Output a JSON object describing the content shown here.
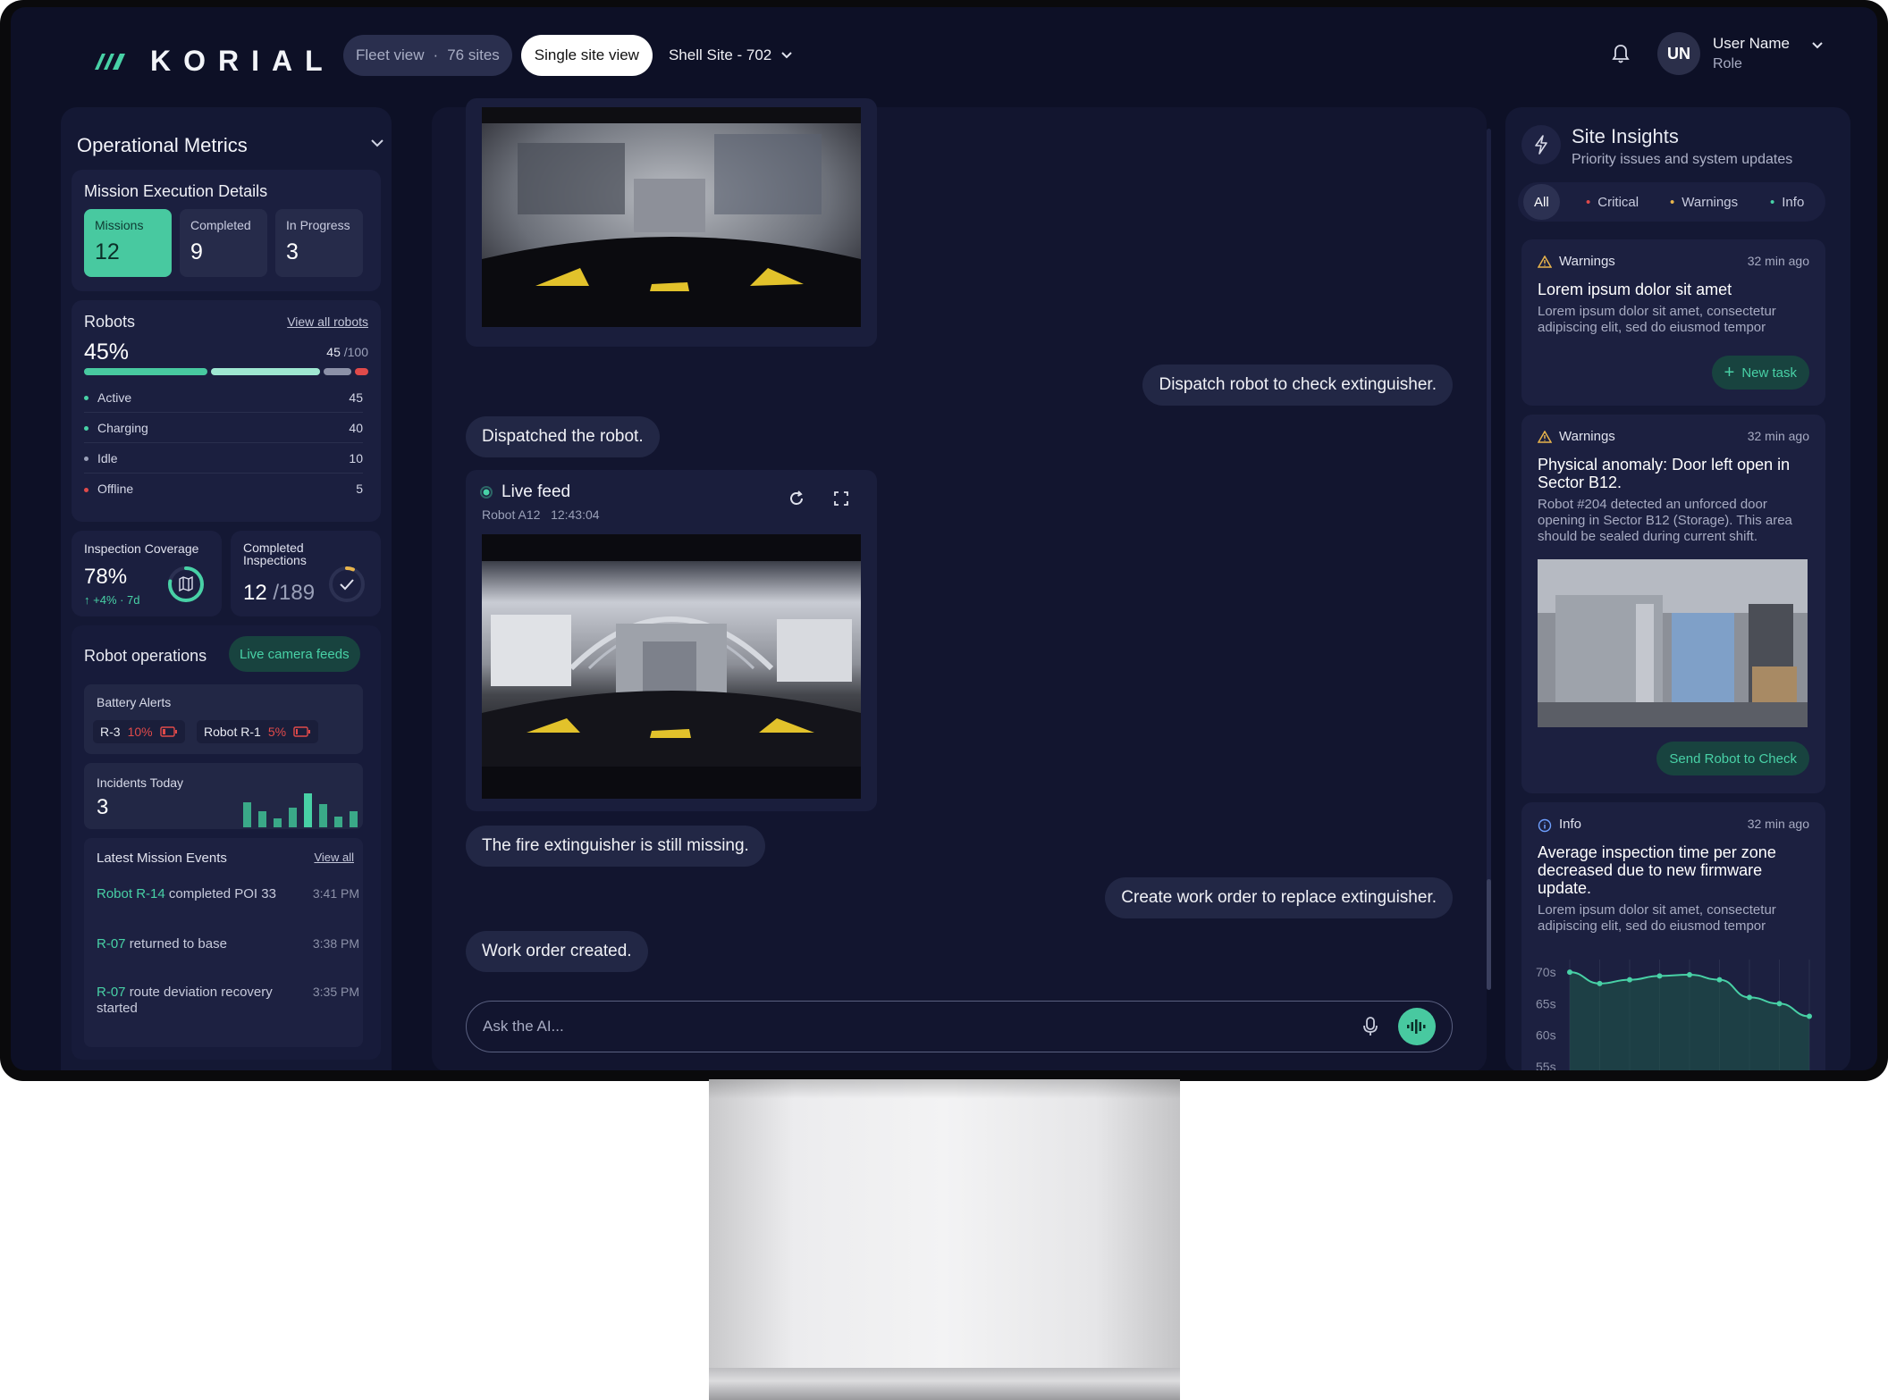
{
  "app": {
    "brand": "KORIAL"
  },
  "header": {
    "fleet_view_label": "Fleet view",
    "fleet_sites": "76 sites",
    "single_site_label": "Single site view",
    "site_name": "Shell Site - 702",
    "user_initials": "UN",
    "user_name": "User Name",
    "user_role": "Role"
  },
  "left": {
    "title": "Operational Metrics",
    "mission": {
      "title": "Mission Execution Details",
      "boxes": [
        {
          "label": "Missions",
          "value": "12"
        },
        {
          "label": "Completed",
          "value": "9"
        },
        {
          "label": "In Progress",
          "value": "3"
        }
      ]
    },
    "robots": {
      "title": "Robots",
      "view_all": "View all robots",
      "percent": "45%",
      "count": "45",
      "total": "/100",
      "statuses": [
        {
          "label": "Active",
          "value": "45",
          "color": "#48d1a6"
        },
        {
          "label": "Charging",
          "value": "40",
          "color": "#48d1a6"
        },
        {
          "label": "Idle",
          "value": "10",
          "color": "#9aa0b8"
        },
        {
          "label": "Offline",
          "value": "5",
          "color": "#e04a4a"
        }
      ]
    },
    "coverage": {
      "label": "Inspection Coverage",
      "value": "78%",
      "delta": "+4% · 7d",
      "fraction": 0.78
    },
    "completed_inspections": {
      "label": "Completed Inspections",
      "value": "12",
      "total": "/189",
      "fraction": 0.063
    },
    "operations": {
      "title": "Robot operations",
      "feeds_btn": "Live camera feeds"
    },
    "battery": {
      "title": "Battery Alerts",
      "items": [
        {
          "name": "R-3",
          "level": "10%"
        },
        {
          "name": "Robot R-1",
          "level": "5%"
        }
      ]
    },
    "incidents": {
      "title": "Incidents Today",
      "value": "3"
    },
    "events": {
      "title": "Latest Mission Events",
      "view_all": "View all",
      "items": [
        {
          "robot": "Robot R-14",
          "text": "completed POI 33",
          "time": "3:41 PM"
        },
        {
          "robot": "R-07",
          "text": "returned to base",
          "time": "3:38 PM"
        },
        {
          "robot": "R-07",
          "text": "route deviation recovery started",
          "time": "3:35 PM"
        }
      ]
    }
  },
  "chat": {
    "messages": [
      {
        "role": "user",
        "text": "Dispatch robot to check extinguisher."
      },
      {
        "role": "assistant",
        "text": "Dispatched the robot."
      },
      {
        "role": "assistant",
        "text": "The fire extinguisher is still missing."
      },
      {
        "role": "user",
        "text": "Create work order to replace extinguisher."
      },
      {
        "role": "assistant",
        "text": "Work order created."
      }
    ],
    "live_feed": {
      "title": "Live feed",
      "robot": "Robot A12",
      "time": "12:43:04"
    },
    "input_placeholder": "Ask the AI..."
  },
  "right": {
    "title": "Site Insights",
    "subtitle": "Priority issues and system updates",
    "filters": [
      "All",
      "Critical",
      "Warnings",
      "Info"
    ],
    "cards": [
      {
        "type": "Warnings",
        "time": "32 min ago",
        "title": "Lorem ipsum dolor sit amet",
        "body": "Lorem ipsum dolor sit amet, consectetur adipiscing elit, sed do eiusmod tempor",
        "action": "New task"
      },
      {
        "type": "Warnings",
        "time": "32 min ago",
        "title": "Physical anomaly: Door left open in Sector B12.",
        "body": "Robot #204 detected an unforced door opening in Sector B12 (Storage). This area should be sealed during current shift.",
        "action": "Send Robot to Check"
      },
      {
        "type": "Info",
        "time": "32 min ago",
        "title": "Average inspection time per zone decreased due to new firmware update.",
        "body": "Lorem ipsum dolor sit amet, consectetur adipiscing elit, sed do eiusmod tempor"
      }
    ]
  },
  "chart_data": {
    "type": "area",
    "title": "",
    "yticks": [
      "70s",
      "65s",
      "60s",
      "55s"
    ],
    "ylim": [
      55,
      72
    ],
    "values": [
      70,
      68.2,
      68.8,
      69.4,
      69.6,
      68.8,
      66,
      65,
      63
    ]
  }
}
